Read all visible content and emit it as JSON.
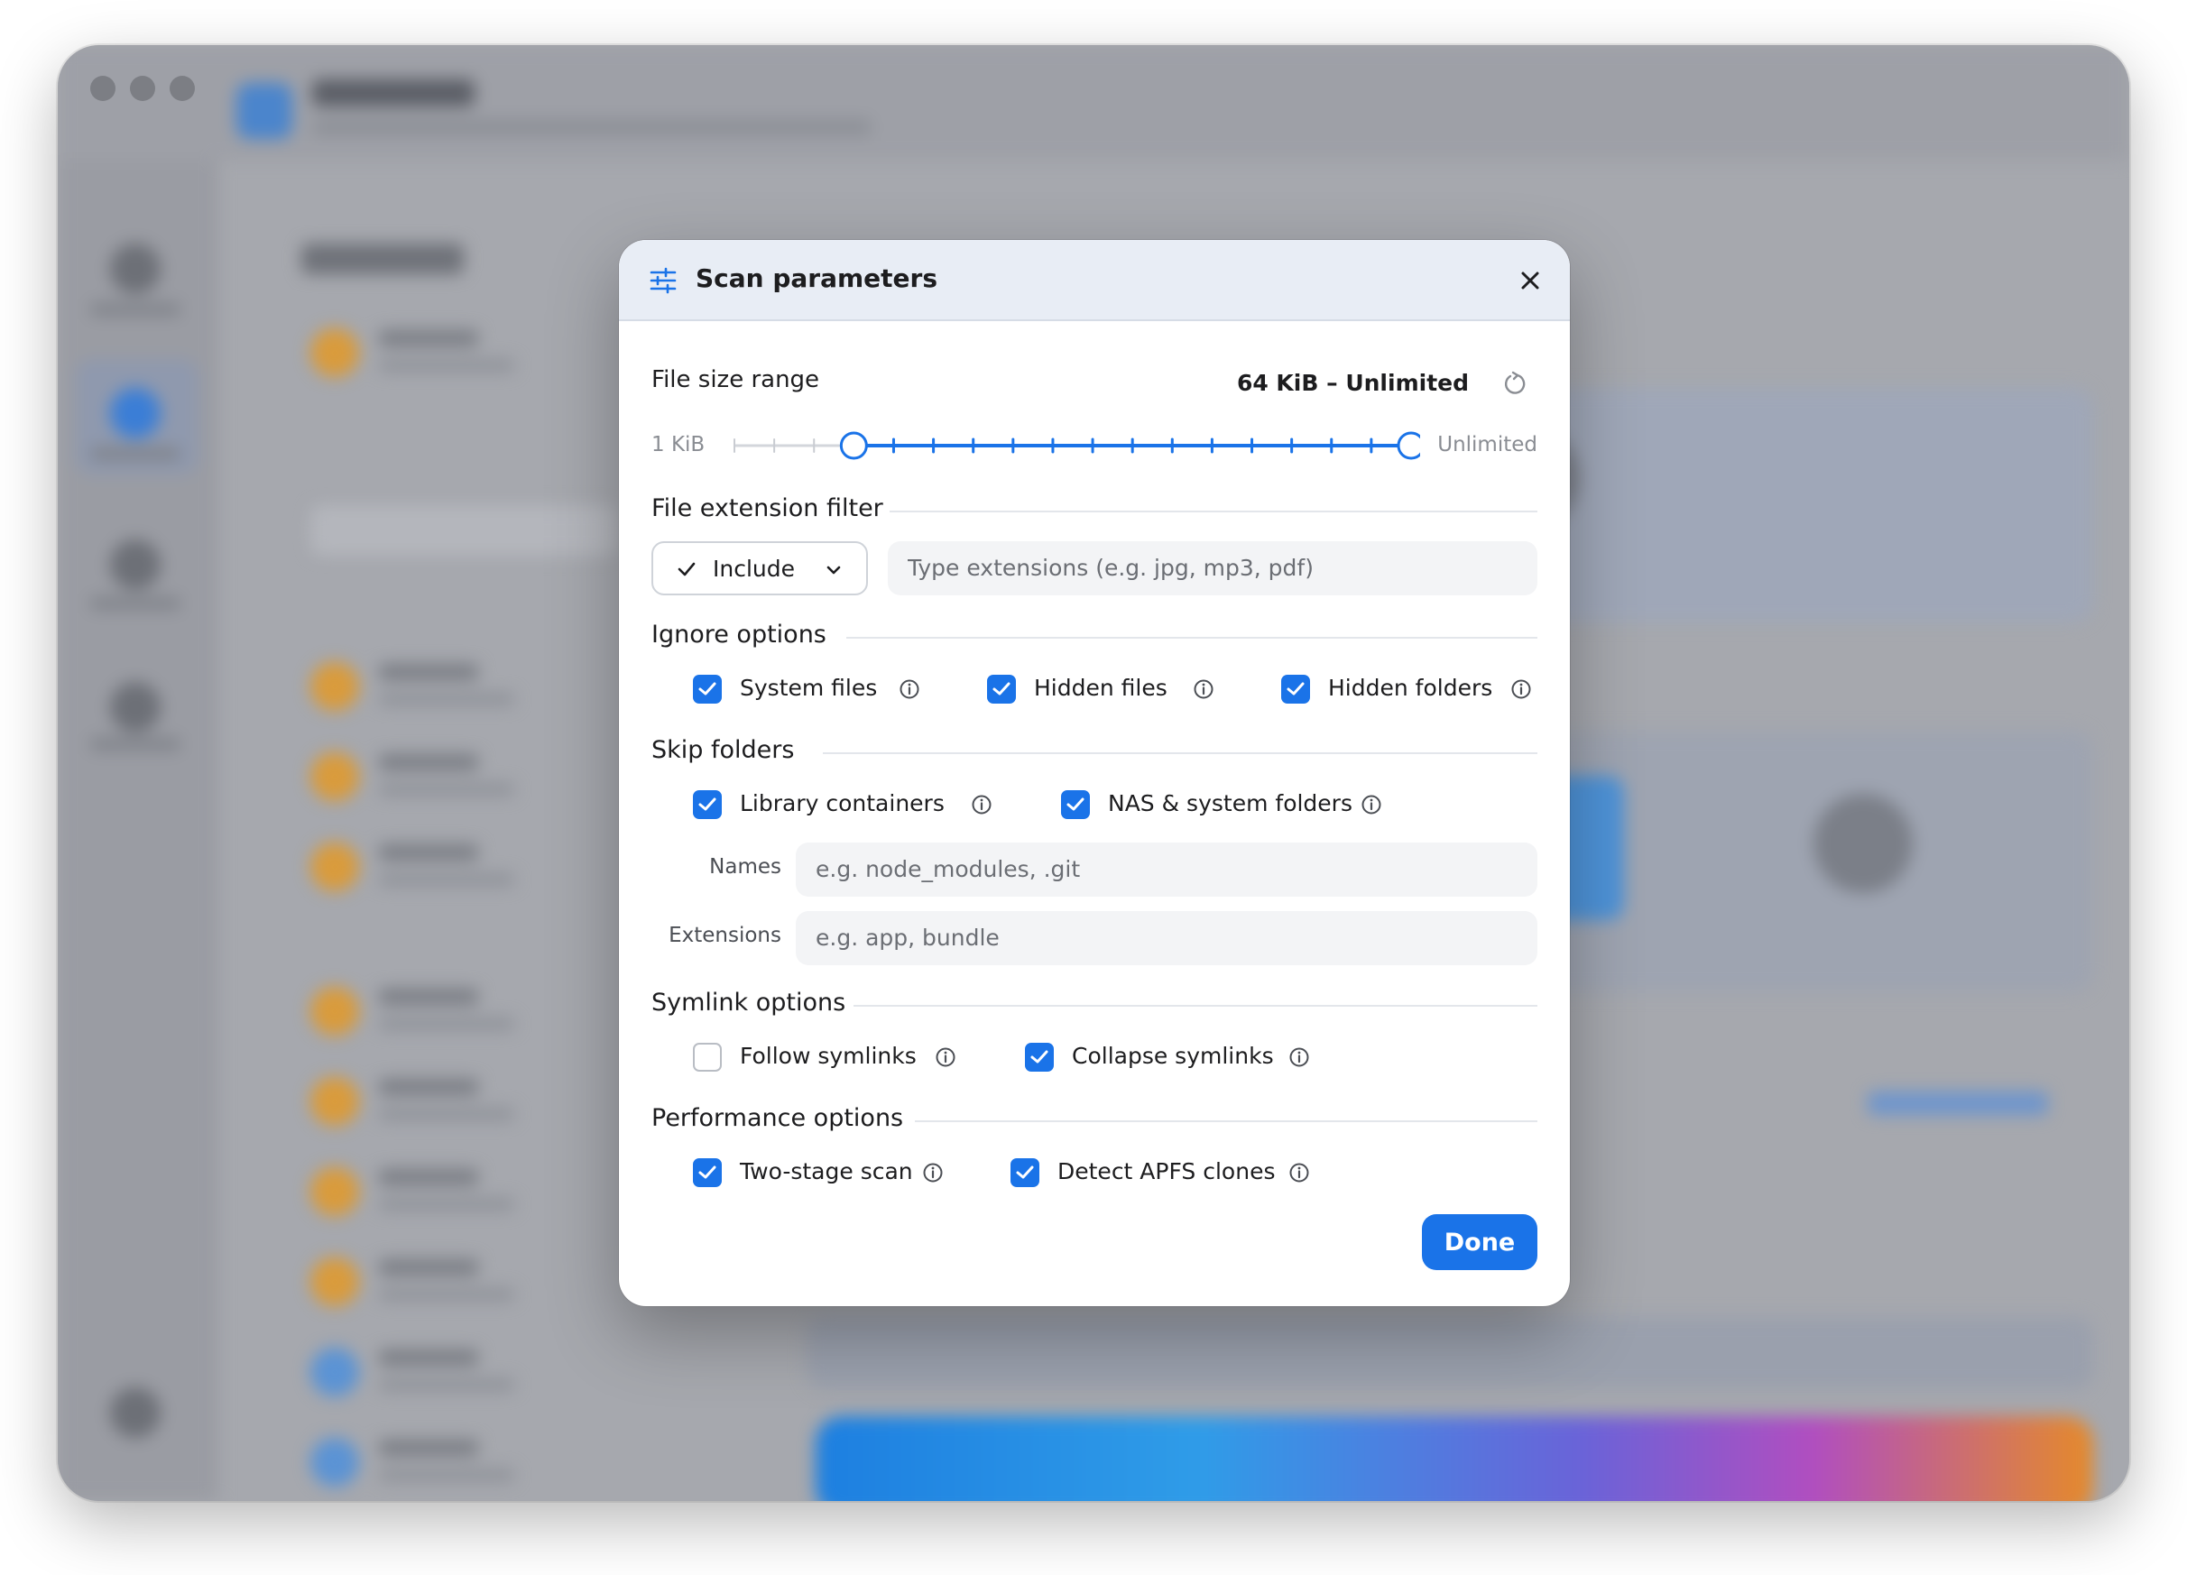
{
  "dialog": {
    "title": "Scan parameters",
    "header_icon": "sliders-icon",
    "close_icon": "close-icon"
  },
  "file_size": {
    "label": "File size range",
    "value_text": "64 KiB – Unlimited",
    "min_label": "1 KiB",
    "max_label": "Unlimited",
    "reset_icon": "reset-icon",
    "steps": 18,
    "selected_low_step": 3,
    "selected_high_step": 17
  },
  "extension_filter": {
    "title": "File extension filter",
    "mode": "Include",
    "input_placeholder": "Type extensions (e.g. jpg, mp3, pdf)"
  },
  "ignore_options": {
    "title": "Ignore options",
    "items": [
      {
        "label": "System files",
        "checked": true
      },
      {
        "label": "Hidden files",
        "checked": true
      },
      {
        "label": "Hidden folders",
        "checked": true
      }
    ]
  },
  "skip_folders": {
    "title": "Skip folders",
    "items": [
      {
        "label": "Library containers",
        "checked": true
      },
      {
        "label": "NAS & system folders",
        "checked": true
      }
    ],
    "names_label": "Names",
    "names_placeholder": "e.g. node_modules, .git",
    "extensions_label": "Extensions",
    "extensions_placeholder": "e.g. app, bundle"
  },
  "symlink_options": {
    "title": "Symlink options",
    "items": [
      {
        "label": "Follow symlinks",
        "checked": false
      },
      {
        "label": "Collapse symlinks",
        "checked": true
      }
    ]
  },
  "performance_options": {
    "title": "Performance options",
    "items": [
      {
        "label": "Two-stage scan",
        "checked": true
      },
      {
        "label": "Detect APFS clones",
        "checked": true
      }
    ]
  },
  "done_label": "Done",
  "colors": {
    "accent": "#1a73e8",
    "header_bg": "#e8edf5",
    "muted_text": "#8a8d93"
  }
}
